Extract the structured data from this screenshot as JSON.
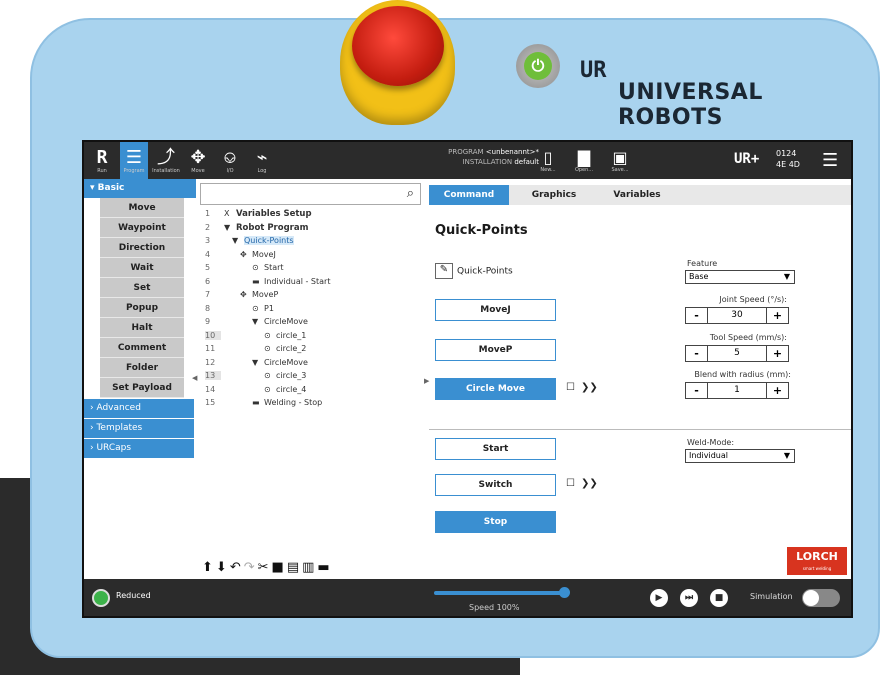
{
  "pendant": {
    "brand_logo": "UR",
    "brand_name": "UNIVERSAL ROBOTS",
    "power_symbol": "⏻"
  },
  "topbar": {
    "nav": [
      {
        "label": "Run",
        "icon": "run-icon"
      },
      {
        "label": "Program",
        "icon": "program-icon"
      },
      {
        "label": "Installation",
        "icon": "installation-icon"
      },
      {
        "label": "Move",
        "icon": "move-icon"
      },
      {
        "label": "I/O",
        "icon": "io-icon"
      },
      {
        "label": "Log",
        "icon": "log-icon"
      }
    ],
    "program_label": "PROGRAM",
    "program_value": "<unbenannt>*",
    "installation_label": "INSTALLATION",
    "installation_value": "default",
    "new_label": "New...",
    "open_label": "Open...",
    "save_label": "Save...",
    "ur_plus": "UR+",
    "serial_line1": "0124",
    "serial_line2": "4E 4D"
  },
  "sidebar": {
    "basic_header": "Basic",
    "items": [
      "Move",
      "Waypoint",
      "Direction",
      "Wait",
      "Set",
      "Popup",
      "Halt",
      "Comment",
      "Folder",
      "Set Payload"
    ],
    "categories": [
      "Advanced",
      "Templates",
      "URCaps"
    ]
  },
  "tree": {
    "search_placeholder": "",
    "lines": [
      {
        "num": "1",
        "text": "Variables Setup",
        "prefix": "X"
      },
      {
        "num": "2",
        "text": "Robot Program",
        "prefix": "▼"
      },
      {
        "num": "3",
        "text": "Quick-Points",
        "prefix": "▼"
      },
      {
        "num": "4",
        "text": "MoveJ",
        "prefix": "✥"
      },
      {
        "num": "5",
        "text": "Start",
        "prefix": "⊙"
      },
      {
        "num": "6",
        "text": "Individual - Start",
        "prefix": "▬"
      },
      {
        "num": "7",
        "text": "MoveP",
        "prefix": "✥"
      },
      {
        "num": "8",
        "text": "P1",
        "prefix": "⊙"
      },
      {
        "num": "9",
        "text": "CircleMove",
        "prefix": "▼"
      },
      {
        "num": "10",
        "text": "circle_1",
        "prefix": "⊙"
      },
      {
        "num": "11",
        "text": "circle_2",
        "prefix": "⊙"
      },
      {
        "num": "12",
        "text": "CircleMove",
        "prefix": "▼"
      },
      {
        "num": "13",
        "text": "circle_3",
        "prefix": "⊙"
      },
      {
        "num": "14",
        "text": "circle_4",
        "prefix": "⊙"
      },
      {
        "num": "15",
        "text": "Welding - Stop",
        "prefix": "▬"
      }
    ]
  },
  "panel": {
    "tabs": [
      "Command",
      "Graphics",
      "Variables"
    ],
    "title": "Quick-Points",
    "quickpoints_label": "Quick-Points",
    "buttons": {
      "movej": "MoveJ",
      "movep": "MoveP",
      "circle_move": "Circle Move",
      "start": "Start",
      "switch": "Switch",
      "stop": "Stop"
    },
    "arrows": "❯❯",
    "feature_label": "Feature",
    "feature_value": "Base",
    "joint_speed_label": "Joint Speed (°/s):",
    "joint_speed_value": "30",
    "tool_speed_label": "Tool Speed (mm/s):",
    "tool_speed_value": "5",
    "blend_label": "Blend with radius (mm):",
    "blend_value": "1",
    "weld_mode_label": "Weld-Mode:",
    "weld_mode_value": "Individual",
    "minus": "-",
    "plus": "+",
    "lorch": "LORCH",
    "lorch_sub": "smart welding"
  },
  "statusbar": {
    "mode": "Reduced",
    "speed_label": "Speed 100%",
    "speed_value": 1.0,
    "simulation_label": "Simulation"
  }
}
